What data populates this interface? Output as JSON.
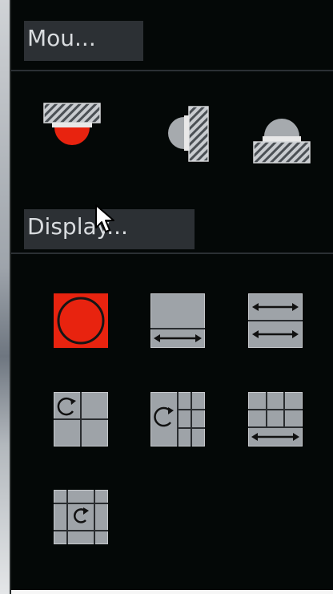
{
  "mount_section": {
    "label": "Mou...",
    "options": [
      {
        "name": "Ceiling mount",
        "icon": "ceiling-mount-icon",
        "selected": true
      },
      {
        "name": "Wall mount",
        "icon": "wall-mount-icon",
        "selected": false
      },
      {
        "name": "Ground mount",
        "icon": "ground-mount-icon",
        "selected": false
      }
    ]
  },
  "display_section": {
    "label": "Display...",
    "modes": [
      {
        "icon": "fisheye-original-icon",
        "selected": true
      },
      {
        "icon": "panorama-icon",
        "selected": false
      },
      {
        "icon": "dual-panorama-icon",
        "selected": false
      },
      {
        "icon": "fisheye-3-split-icon",
        "selected": false
      },
      {
        "icon": "fisheye-4-split-icon",
        "selected": false
      },
      {
        "icon": "panorama-3-split-icon",
        "selected": false
      },
      {
        "icon": "fisheye-9-split-icon",
        "selected": false
      }
    ]
  },
  "colors": {
    "panel_bg": "#040807",
    "label_bg": "#2c3034",
    "selected_red": "#e8230f",
    "icon_gray": "#9ea3a8"
  }
}
